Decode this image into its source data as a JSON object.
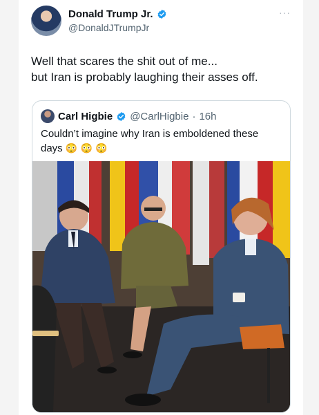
{
  "post": {
    "author_name": "Donald Trump Jr.",
    "author_handle": "@DonaldJTrumpJr",
    "more_label": "···",
    "text": "Well that scares the shit out of me...\nbut Iran is probably laughing their asses off."
  },
  "quoted": {
    "author_name": "Carl Higbie",
    "author_handle": "@CarlHigbie",
    "separator": "·",
    "time": "16h",
    "text": "Couldn’t imagine why Iran is emboldened these days",
    "emojis": [
      "😳",
      "😳",
      "😳"
    ]
  },
  "icons": {
    "verified": "verified-badge-icon",
    "more": "more-icon"
  },
  "colors": {
    "verified_blue": "#1d9bf0",
    "secondary_text": "#536471",
    "border": "#cfd9de"
  }
}
